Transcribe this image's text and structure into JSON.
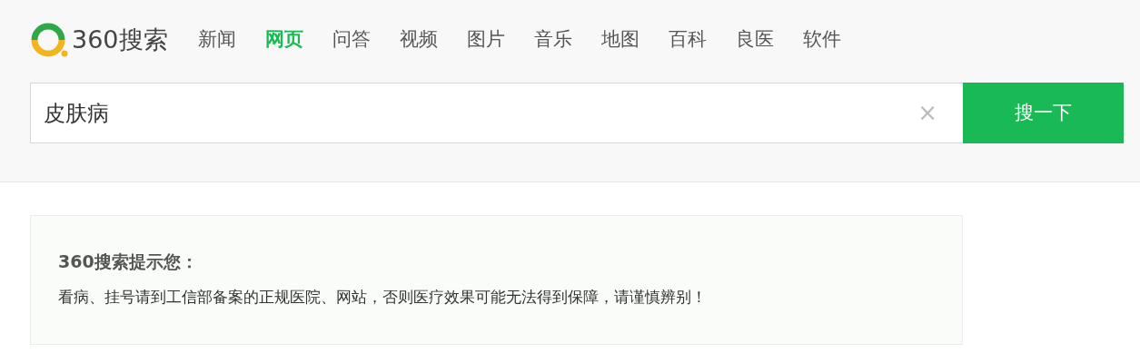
{
  "logo": {
    "text": "360搜索"
  },
  "tabs": [
    {
      "label": "新闻",
      "selected": false
    },
    {
      "label": "网页",
      "selected": true
    },
    {
      "label": "问答",
      "selected": false
    },
    {
      "label": "视频",
      "selected": false
    },
    {
      "label": "图片",
      "selected": false
    },
    {
      "label": "音乐",
      "selected": false
    },
    {
      "label": "地图",
      "selected": false
    },
    {
      "label": "百科",
      "selected": false
    },
    {
      "label": "良医",
      "selected": false
    },
    {
      "label": "软件",
      "selected": false
    }
  ],
  "search": {
    "value": "皮肤病",
    "clear": "×",
    "button": "搜一下"
  },
  "notice": {
    "title": "360搜索提示您：",
    "text": "看病、挂号请到工信部备案的正规医院、网站，否则医疗效果可能无法得到保障，请谨慎辨别！"
  }
}
